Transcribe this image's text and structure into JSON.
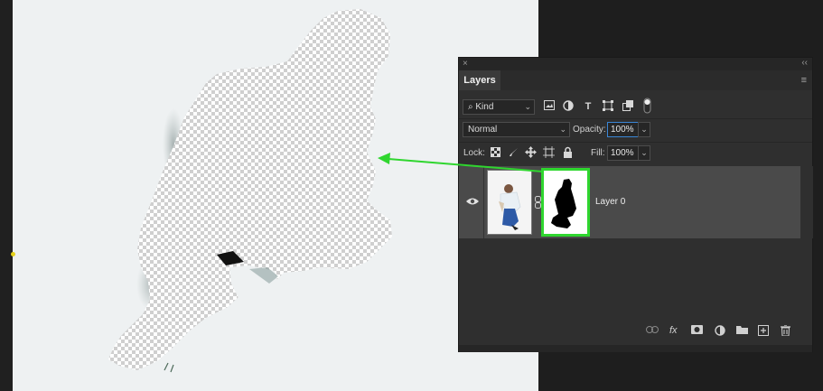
{
  "panel": {
    "close_glyph": "×",
    "collapse_glyph": "‹‹",
    "tab_label": "Layers",
    "menu_glyph": "≡"
  },
  "filter": {
    "kind_label": "Kind",
    "search_glyph": "⌕",
    "chevron_glyph": "⌄",
    "icons": [
      "image-filter-icon",
      "adjustment-filter-icon",
      "type-filter-icon",
      "shape-filter-icon",
      "smart-object-filter-icon",
      "filter-toggle-icon"
    ]
  },
  "blend": {
    "mode": "Normal",
    "opacity_label": "Opacity:",
    "opacity_value": "100%"
  },
  "lock": {
    "lock_label": "Lock:",
    "fill_label": "Fill:",
    "fill_value": "100%"
  },
  "layers": [
    {
      "name": "Layer 0",
      "visible": true,
      "has_mask": true
    }
  ],
  "toolbar": {
    "fx_label": "fx"
  },
  "colors": {
    "mask_highlight": "#2fd62f",
    "arrow": "#2fd62f",
    "focus_blue": "#3a86d6"
  }
}
